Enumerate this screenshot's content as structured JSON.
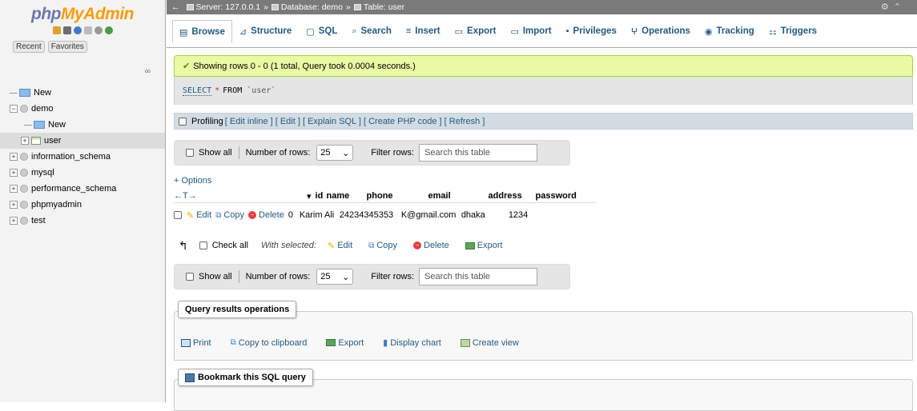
{
  "sidebar": {
    "logo": {
      "part1": "php",
      "part2": "MyAdmin"
    },
    "recent_label": "Recent",
    "favorites_label": "Favorites",
    "tree": [
      {
        "label": "New",
        "type": "new",
        "level": 0
      },
      {
        "label": "demo",
        "type": "db",
        "level": 0
      },
      {
        "label": "New",
        "type": "new",
        "level": 1
      },
      {
        "label": "user",
        "type": "table",
        "level": 1,
        "selected": true
      },
      {
        "label": "information_schema",
        "type": "db",
        "level": 0
      },
      {
        "label": "mysql",
        "type": "db",
        "level": 0
      },
      {
        "label": "performance_schema",
        "type": "db",
        "level": 0
      },
      {
        "label": "phpmyadmin",
        "type": "db",
        "level": 0
      },
      {
        "label": "test",
        "type": "db",
        "level": 0
      }
    ]
  },
  "breadcrumb": {
    "server": "Server: 127.0.0.1",
    "database": "Database: demo",
    "table": "Table: user"
  },
  "tabs": [
    {
      "label": "Browse",
      "icon": "browse-icon",
      "active": true
    },
    {
      "label": "Structure",
      "icon": "structure-icon"
    },
    {
      "label": "SQL",
      "icon": "sql-icon"
    },
    {
      "label": "Search",
      "icon": "search-icon"
    },
    {
      "label": "Insert",
      "icon": "insert-icon"
    },
    {
      "label": "Export",
      "icon": "export-icon"
    },
    {
      "label": "Import",
      "icon": "import-icon"
    },
    {
      "label": "Privileges",
      "icon": "privileges-icon"
    },
    {
      "label": "Operations",
      "icon": "operations-icon"
    },
    {
      "label": "Tracking",
      "icon": "tracking-icon"
    },
    {
      "label": "Triggers",
      "icon": "triggers-icon"
    }
  ],
  "success_message": "Showing rows 0 - 0 (1 total, Query took 0.0004 seconds.)",
  "sql": {
    "select": "SELECT",
    "star": "*",
    "from": "FROM",
    "table": "`user`"
  },
  "profiling": {
    "label": "Profiling",
    "links": "[ Edit inline ] [ Edit ] [ Explain SQL ] [ Create PHP code ] [ Refresh ]"
  },
  "nav": {
    "show_all": "Show all",
    "rows_label": "Number of rows:",
    "rows_value": "25",
    "filter_label": "Filter rows:",
    "filter_placeholder": "Search this table"
  },
  "options_label": "+ Options",
  "table": {
    "arrows": "←T→",
    "columns": [
      "id",
      "name",
      "phone",
      "email",
      "address",
      "password"
    ],
    "row": {
      "edit": "Edit",
      "copy": "Copy",
      "delete": "Delete",
      "id": "0",
      "name": "Karim Ali",
      "phone": "24234345353",
      "email": "K@gmail.com",
      "address": "dhaka",
      "password": "1234"
    }
  },
  "bulk": {
    "check_all": "Check all",
    "with_selected": "With selected:",
    "edit": "Edit",
    "copy": "Copy",
    "delete": "Delete",
    "export": "Export"
  },
  "query_ops": {
    "legend": "Query results operations",
    "print": "Print",
    "copy": "Copy to clipboard",
    "export": "Export",
    "chart": "Display chart",
    "view": "Create view"
  },
  "bookmark": {
    "legend": "Bookmark this SQL query"
  }
}
